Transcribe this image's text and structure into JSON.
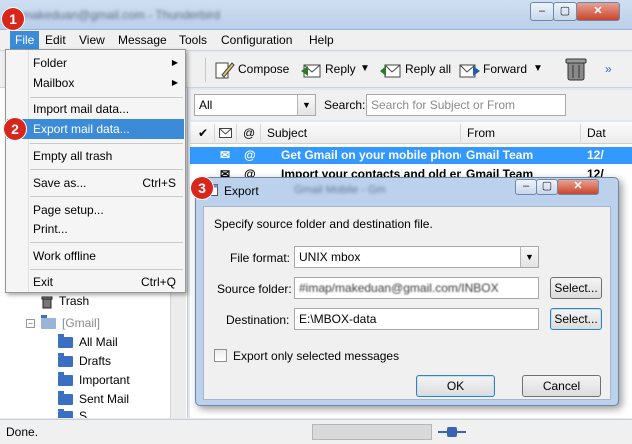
{
  "window": {
    "title": "makeduan@gmail.com - Thunderbird",
    "min": "–",
    "max": "▢",
    "close": "✕"
  },
  "menubar": [
    "File",
    "Edit",
    "View",
    "Message",
    "Tools",
    "Configuration",
    "Help"
  ],
  "toolbar": {
    "compose": "Compose",
    "reply": "Reply",
    "reply_all": "Reply all",
    "forward": "Forward",
    "more": "»"
  },
  "filter": {
    "scope_value": "All",
    "search_label": "Search:",
    "search_placeholder": "Search for Subject or From"
  },
  "file_menu": {
    "folder": "Folder",
    "mailbox": "Mailbox",
    "import": "Import mail data...",
    "export": "Export mail data...",
    "empty_trash": "Empty all trash",
    "save_as": "Save as...",
    "save_as_shortcut": "Ctrl+S",
    "page_setup": "Page setup...",
    "print": "Print...",
    "work_offline": "Work offline",
    "exit": "Exit",
    "exit_shortcut": "Ctrl+Q"
  },
  "folders": {
    "trash": "Trash",
    "gmail": "[Gmail]",
    "all_mail": "All Mail",
    "drafts": "Drafts",
    "important": "Important",
    "sent_mail": "Sent Mail",
    "cut": "S..."
  },
  "message_list": {
    "columns": {
      "subject": "Subject",
      "from": "From",
      "date": "Dat"
    },
    "rows": [
      {
        "subject": "Get Gmail on your mobile phone",
        "from": "Gmail Team",
        "date": "12/"
      },
      {
        "subject": "Import your contacts and old em",
        "from": "Gmail Team",
        "date": "12/"
      }
    ]
  },
  "export_dialog": {
    "title": "Export",
    "title_extra": "Gmail Mobile - Gm",
    "instructions": "Specify source folder and destination file.",
    "file_format_label": "File format:",
    "file_format_value": "UNIX mbox",
    "source_label": "Source folder:",
    "source_value": "#imap/makeduan@gmail.com/INBOX",
    "destination_label": "Destination:",
    "destination_value": "E:\\MBOX-data",
    "select": "Select...",
    "only_selected": "Export only selected messages",
    "ok": "OK",
    "cancel": "Cancel"
  },
  "badges": [
    "1",
    "2",
    "3"
  ],
  "status": {
    "text": "Done."
  },
  "colors": {
    "highlight": "#3c8bd8",
    "selection": "#3399ff",
    "badge": "#d9261c"
  }
}
